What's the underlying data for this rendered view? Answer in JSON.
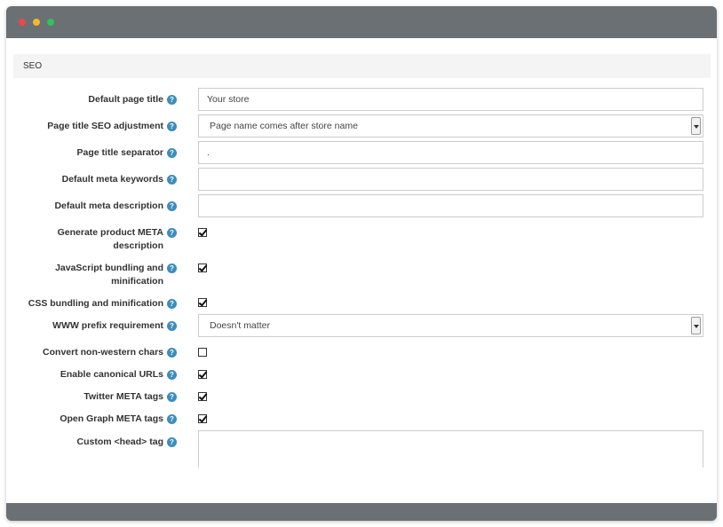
{
  "panel": {
    "title": "SEO"
  },
  "help_glyph": "?",
  "fields": {
    "default_page_title": {
      "label": "Default page title",
      "value": "Your store"
    },
    "title_seo_adjustment": {
      "label": "Page title SEO adjustment",
      "value": "Page name comes after store name"
    },
    "title_separator": {
      "label": "Page title separator",
      "value": "."
    },
    "meta_keywords": {
      "label": "Default meta keywords",
      "value": ""
    },
    "meta_description": {
      "label": "Default meta description",
      "value": ""
    },
    "generate_product_meta": {
      "label_line1": "Generate product META",
      "label_line2": "description",
      "checked": true
    },
    "js_bundling": {
      "label_line1": "JavaScript bundling and",
      "label_line2": "minification",
      "checked": true
    },
    "css_bundling": {
      "label": "CSS bundling and minification",
      "checked": true
    },
    "www_prefix": {
      "label": "WWW prefix requirement",
      "value": "Doesn't matter"
    },
    "convert_non_western": {
      "label": "Convert non-western chars",
      "checked": false
    },
    "canonical_urls": {
      "label": "Enable canonical URLs",
      "checked": true
    },
    "twitter_meta": {
      "label": "Twitter META tags",
      "checked": true
    },
    "open_graph_meta": {
      "label": "Open Graph META tags",
      "checked": true
    },
    "custom_head_tag": {
      "label": "Custom <head> tag",
      "value": ""
    }
  }
}
